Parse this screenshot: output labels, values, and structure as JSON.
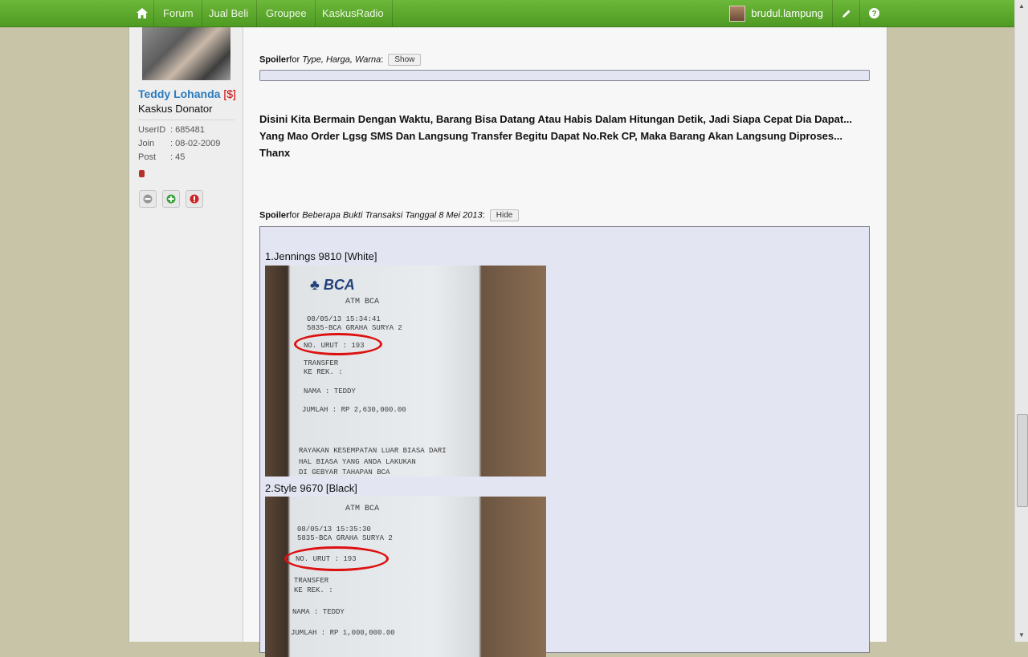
{
  "nav": {
    "home_icon": "home-icon",
    "items": [
      "Forum",
      "Jual Beli",
      "Groupee",
      "KaskusRadio"
    ],
    "user": "brudul.lampung",
    "edit_icon": "pencil-icon",
    "help_icon": "question-icon"
  },
  "profile": {
    "name": "Teddy Lohanda",
    "name_tag": "[$]",
    "title": "Kaskus Donator",
    "stats": [
      {
        "label": "UserID",
        "value": ": 685481"
      },
      {
        "label": "Join",
        "value": ": 08-02-2009"
      },
      {
        "label": "Post",
        "value": ": 45"
      }
    ]
  },
  "post": {
    "spoiler1": {
      "label": "Spoiler",
      "for": "for",
      "title": "Type, Harga, Warna",
      "button": "Show"
    },
    "paragraph": [
      "Disini Kita Bermain Dengan Waktu, Barang Bisa Datang Atau Habis Dalam Hitungan Detik, Jadi Siapa Cepat Dia Dapat... Yang Mao Order Lgsg SMS Dan Langsung Transfer Begitu Dapat No.Rek CP, Maka Barang Akan Langsung Diproses...",
      "Thanx"
    ],
    "spoiler2": {
      "label": "Spoiler",
      "for": "for",
      "title": "Beberapa Bukti Transaksi Tanggal 8 Mei 2013",
      "button": "Hide"
    },
    "items": [
      {
        "label": "1.Jennings 9810 [White]",
        "receipt": [
          "ATM BCA",
          "08/05/13   15:34:41",
          "5835-BCA GRAHA SURYA 2",
          "NO. URUT : 193",
          "TRANSFER",
          "KE REK.  :",
          "NAMA     : TEDDY",
          "JUMLAH   : RP       2,630,000.00",
          "RAYAKAN KESEMPATAN LUAR BIASA DARI",
          "HAL BIASA YANG ANDA LAKUKAN",
          "DI GEBYAR TAHAPAN BCA"
        ]
      },
      {
        "label": "2.Style 9670 [Black]",
        "receipt": [
          "ATM BCA",
          "08/05/13   15:35:30",
          "5835-BCA GRAHA SURYA 2",
          "NO. URUT : 193",
          "TRANSFER",
          "KE REK.  :",
          "NAMA     : TEDDY",
          "JUMLAH   : RP       1,000,000.00"
        ]
      }
    ]
  }
}
